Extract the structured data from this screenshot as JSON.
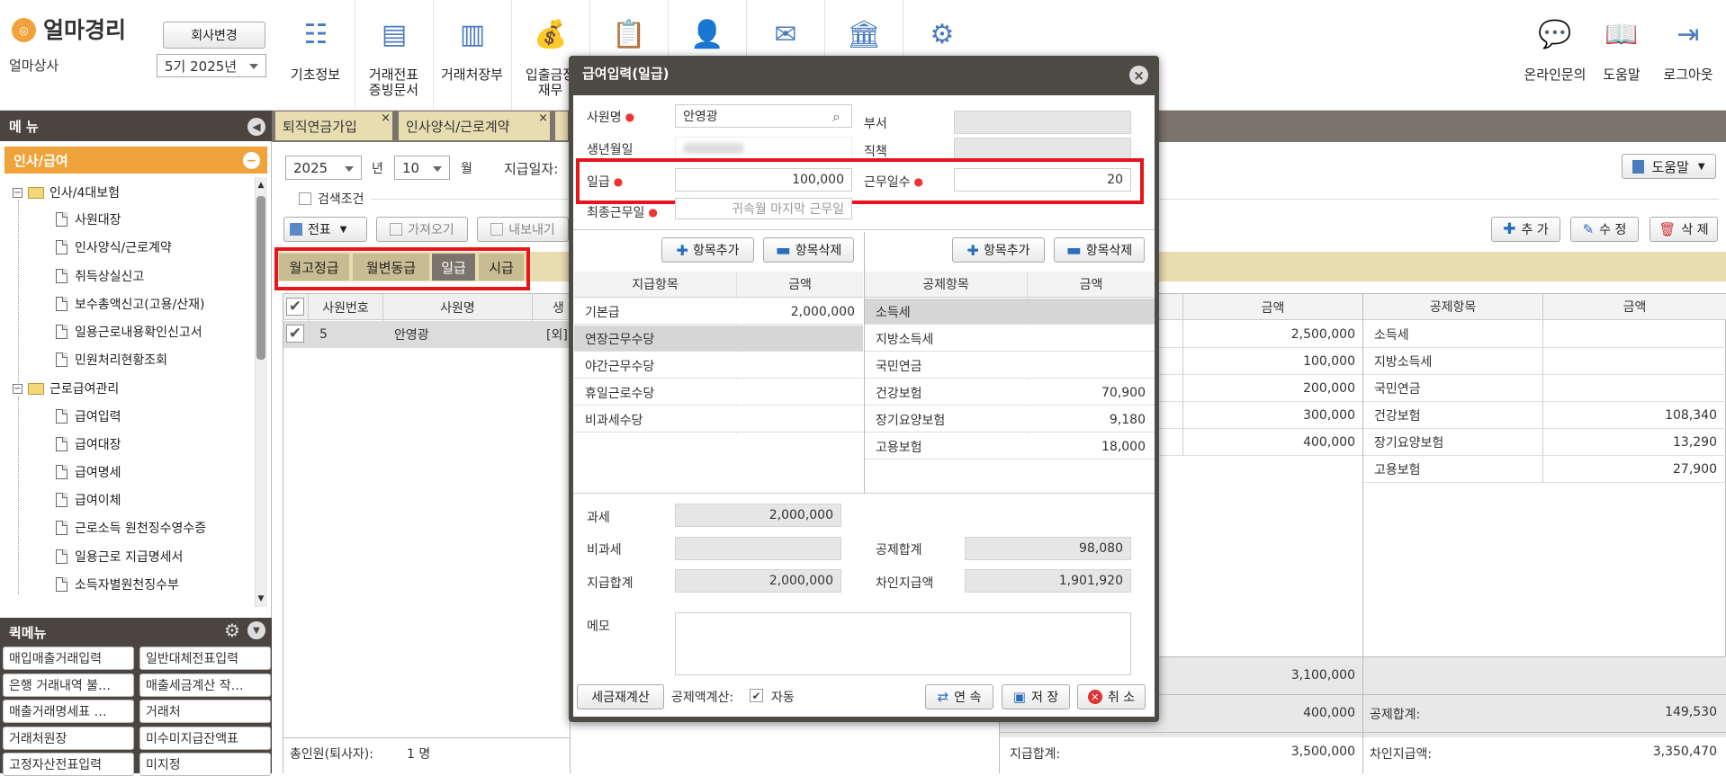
{
  "app": {
    "logo_text": "얼마경리",
    "company": "얼마상사",
    "change_company": "회사변경",
    "period": "5기 2025년"
  },
  "toolbar": {
    "items": [
      {
        "label": "기초정보",
        "icon": "basic-info-icon"
      },
      {
        "label": "거래전표\n증빙문서",
        "icon": "voucher-icon"
      },
      {
        "label": "거래처장부",
        "icon": "ledger-icon"
      },
      {
        "label": "입출금장\n재무",
        "icon": "money-bag-icon"
      },
      {
        "label": "",
        "icon": "clipboard-icon"
      },
      {
        "label": "",
        "icon": "employee-icon"
      },
      {
        "label": "",
        "icon": "tax-icon"
      },
      {
        "label": "",
        "icon": "bank-icon"
      },
      {
        "label": "",
        "icon": "settings-gear-icon"
      }
    ],
    "right": [
      {
        "label": "온라인문의",
        "icon": "online-support-icon"
      },
      {
        "label": "도움말",
        "icon": "help-book-icon"
      },
      {
        "label": "로그아웃",
        "icon": "logout-icon"
      }
    ]
  },
  "sidebar": {
    "title": "메 뉴",
    "section": "인사/급여",
    "groups": [
      {
        "label": "인사/4대보험",
        "items": [
          "사원대장",
          "인사양식/근로계약",
          "취득상실신고",
          "보수총액신고(고용/산재)",
          "일용근로내용확인신고서",
          "민원처리현황조회"
        ]
      },
      {
        "label": "근로급여관리",
        "items": [
          "급여입력",
          "급여대장",
          "급여명세",
          "급여이체",
          "근로소득 원천징수영수증",
          "일용근로 지급명세서",
          "소득자별원천징수부"
        ]
      }
    ],
    "quick_title": "퀵메뉴",
    "quick": [
      "매입매출거래입력",
      "일반대체전표입력",
      "은행 거래내역 불…",
      "매출세금계산 작…",
      "매출거래명세표 …",
      "거래처",
      "거래처원장",
      "미수미지급잔액표",
      "고정자산전표입력",
      "미지정"
    ]
  },
  "tabs": [
    {
      "label": "퇴직연금가입"
    },
    {
      "label": "인사양식/근로계약"
    }
  ],
  "filter": {
    "year": "2025",
    "year_unit": "년",
    "month": "10",
    "month_unit": "월",
    "pay_date_label": "지급일자:",
    "search_cond": "검색조건",
    "help": "도움말"
  },
  "actions": {
    "voucher": "전표",
    "import": "가져오기",
    "export": "내보내기",
    "add": "추 가",
    "edit": "수 정",
    "delete": "삭 제"
  },
  "pay_tabs": [
    "월고정급",
    "월변동급",
    "일급",
    "시급"
  ],
  "emp_table": {
    "headers": [
      "사원번호",
      "사원명",
      "생"
    ],
    "rows": [
      {
        "no": "5",
        "name": "안영광",
        "extra": "[외]"
      }
    ],
    "footer_label": "총인원(퇴사자):",
    "footer_value": "1 명"
  },
  "bg_pay": {
    "header_amount": "금액",
    "amounts": [
      "2,500,000",
      "100,000",
      "200,000",
      "300,000",
      "400,000"
    ],
    "taxable_total": "3,100,000",
    "nontaxable_total": "400,000",
    "pay_total_label": "지급합계:",
    "pay_total": "3,500,000"
  },
  "bg_deduct": {
    "headers": [
      "공제항목",
      "금액"
    ],
    "rows": [
      {
        "item": "소득세",
        "amount": ""
      },
      {
        "item": "지방소득세",
        "amount": ""
      },
      {
        "item": "국민연금",
        "amount": ""
      },
      {
        "item": "건강보험",
        "amount": "108,340"
      },
      {
        "item": "장기요양보험",
        "amount": "13,290"
      },
      {
        "item": "고용보험",
        "amount": "27,900"
      }
    ],
    "total_label": "공제합계:",
    "total": "149,530",
    "net_label": "차인지급액:",
    "net": "3,350,470"
  },
  "dialog": {
    "title": "급여입력(일급)",
    "emp_name_label": "사원명",
    "emp_name": "안영광",
    "birth_label": "생년월일",
    "daily_label": "일급",
    "daily": "100,000",
    "last_day_label": "최종근무일",
    "last_day_placeholder": "귀속월 마지막 근무일",
    "dept_label": "부서",
    "position_label": "직책",
    "workdays_label": "근무일수",
    "workdays": "20",
    "add_item": "항목추가",
    "del_item": "항목삭제",
    "pay_headers": [
      "지급항목",
      "금액"
    ],
    "pay_rows": [
      {
        "item": "기본급",
        "amount": "2,000,000"
      },
      {
        "item": "연장근무수당",
        "amount": ""
      },
      {
        "item": "야간근무수당",
        "amount": ""
      },
      {
        "item": "휴일근로수당",
        "amount": ""
      },
      {
        "item": "비과세수당",
        "amount": ""
      }
    ],
    "deduct_headers": [
      "공제항목",
      "금액"
    ],
    "deduct_rows": [
      {
        "item": "소득세",
        "amount": ""
      },
      {
        "item": "지방소득세",
        "amount": ""
      },
      {
        "item": "국민연금",
        "amount": ""
      },
      {
        "item": "건강보험",
        "amount": "70,900"
      },
      {
        "item": "장기요양보험",
        "amount": "9,180"
      },
      {
        "item": "고용보험",
        "amount": "18,000"
      }
    ],
    "taxable_label": "과세",
    "taxable": "2,000,000",
    "nontaxable_label": "비과세",
    "nontaxable": "",
    "pay_total_label": "지급합계",
    "pay_total": "2,000,000",
    "deduct_total_label": "공제합계",
    "deduct_total": "98,080",
    "net_label": "차인지급액",
    "net": "1,901,920",
    "memo_label": "메모",
    "recalc": "세금재계산",
    "auto_label": "공제액계산:",
    "auto": "자동",
    "continue": "연 속",
    "save": "저 장",
    "cancel": "취 소"
  },
  "colors": {
    "sidebar_bg": "#4a4540",
    "accent": "#f0a33a",
    "highlight": "#e8141c",
    "dialog_header": "#4e4a45"
  }
}
